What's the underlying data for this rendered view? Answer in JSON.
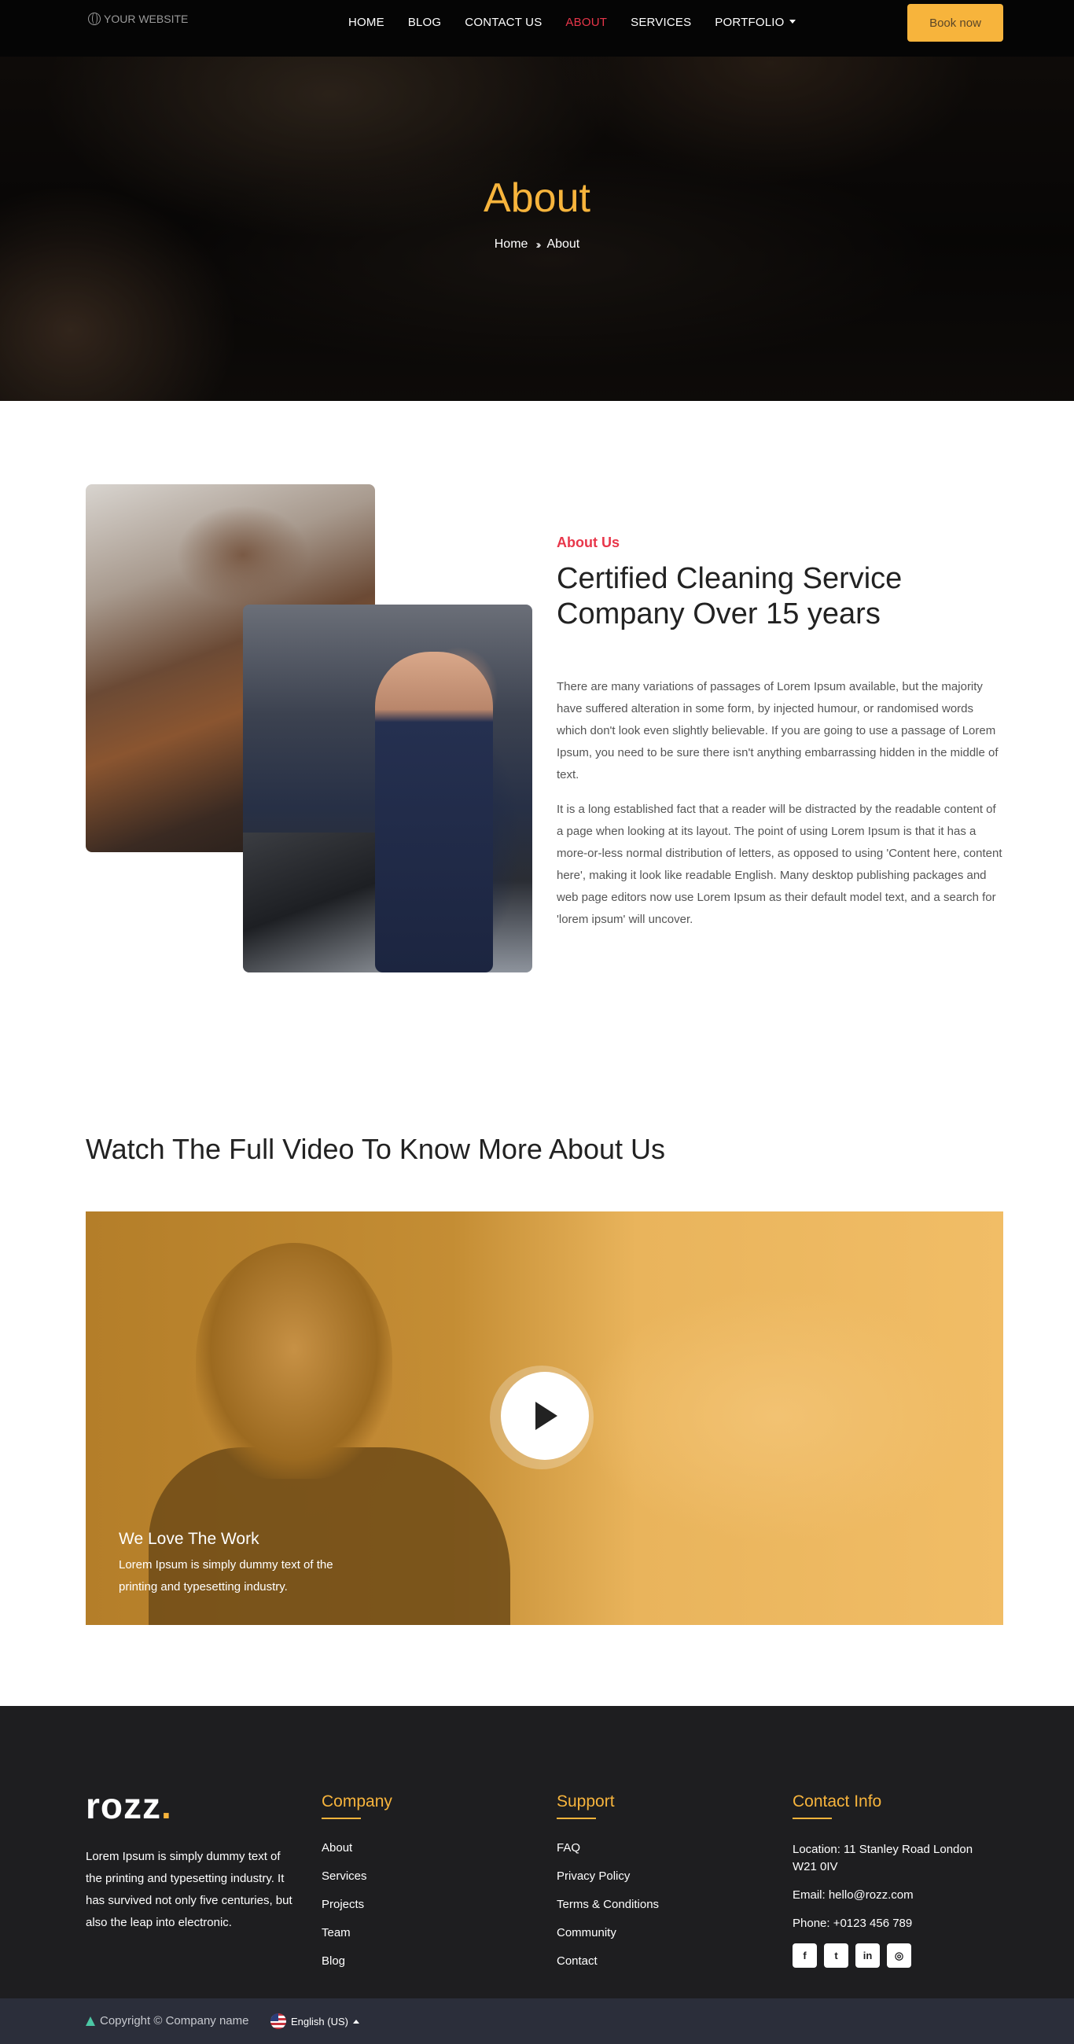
{
  "header": {
    "logo_text": "YOUR WEBSITE",
    "nav": [
      "HOME",
      "BLOG",
      "CONTACT US",
      "ABOUT",
      "SERVICES",
      "PORTFOLIO"
    ],
    "active_nav": "ABOUT",
    "book_button": "Book now",
    "accent_color": "#f7b43c",
    "active_color": "#e8364a"
  },
  "hero": {
    "title": "About",
    "breadcrumb": [
      "Home",
      "About"
    ]
  },
  "about": {
    "kicker": "About Us",
    "title": "Certified Cleaning Service Company Over 15 years",
    "paragraph_1": "There are many variations of passages of Lorem Ipsum available, but the majority have suffered alteration in some form, by injected humour, or randomised words which don't look even slightly believable. If you are going to use a passage of Lorem Ipsum, you need to be sure there isn't anything embarrassing hidden in the middle of text.",
    "paragraph_2": "It is a long established fact that a reader will be distracted by the readable content of a page when looking at its layout. The point of using Lorem Ipsum is that it has a more-or-less normal distribution of letters, as opposed to using 'Content here, content here', making it look like readable English. Many desktop publishing packages and web page editors now use Lorem Ipsum as their default model text, and a search for 'lorem ipsum' will uncover."
  },
  "video": {
    "heading": "Watch The Full Video To Know More About Us",
    "title": "We Love The Work",
    "text": "Lorem Ipsum is simply dummy text of the printing and typesetting industry."
  },
  "footer": {
    "brand": "rozz",
    "brand_dot": ".",
    "about_text": "Lorem Ipsum is simply dummy text of the printing and typesetting industry. It has survived not only five centuries, but also the leap into electronic.",
    "company": {
      "title": "Company",
      "links": [
        "About",
        "Services",
        "Projects",
        "Team",
        "Blog"
      ]
    },
    "support": {
      "title": "Support",
      "links": [
        "FAQ",
        "Privacy Policy",
        "Terms & Conditions",
        "Community",
        "Contact"
      ]
    },
    "contact": {
      "title": "Contact Info",
      "location": "Location: 11 Stanley Road London W21 0IV",
      "email": "Email:  hello@rozz.com",
      "phone": "Phone:  +0123 456 789",
      "social_icons": [
        "facebook-icon",
        "twitter-icon",
        "linkedin-icon",
        "instagram-icon"
      ]
    },
    "copyright": "Copyright © Company name",
    "language": "English (US)"
  }
}
